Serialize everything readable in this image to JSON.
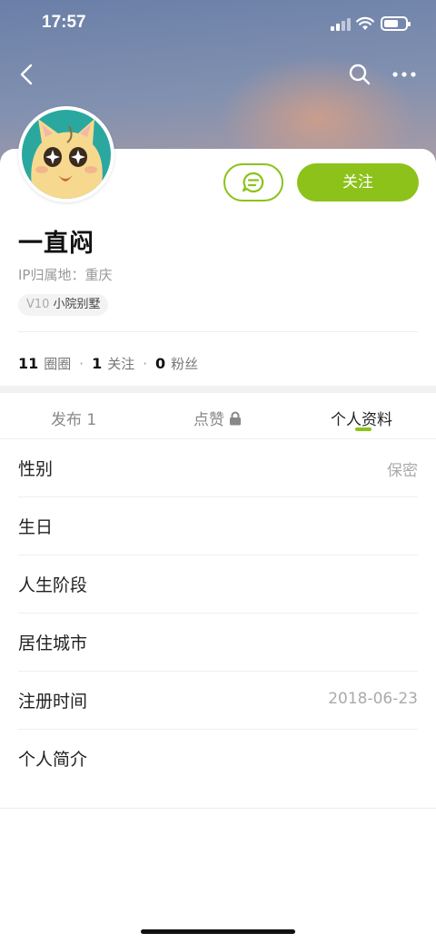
{
  "status_bar": {
    "time": "17:57"
  },
  "colors": {
    "accent": "#8cc21a",
    "avatar_bg": "#2aa8a0"
  },
  "icons": {
    "back": "chevron-left-icon",
    "search": "search-icon",
    "more": "more-dots-icon",
    "message": "message-bubble-icon",
    "lock": "lock-icon"
  },
  "profile": {
    "username": "一直闷",
    "ip_location": "IP归属地：重庆",
    "level": "V10",
    "level_title": "小院别墅",
    "follow_label": "关注"
  },
  "stats": {
    "circles_count": "11",
    "circles_label": "圈圈",
    "following_count": "1",
    "following_label": "关注",
    "followers_count": "0",
    "followers_label": "粉丝"
  },
  "tabs": [
    {
      "label": "发布 1"
    },
    {
      "label": "点赞"
    },
    {
      "label": "个人资料"
    }
  ],
  "info_rows": [
    {
      "label": "性别",
      "value": "保密"
    },
    {
      "label": "生日",
      "value": ""
    },
    {
      "label": "人生阶段",
      "value": ""
    },
    {
      "label": "居住城市",
      "value": ""
    },
    {
      "label": "注册时间",
      "value": "2018-06-23"
    },
    {
      "label": "个人简介",
      "value": ""
    }
  ]
}
